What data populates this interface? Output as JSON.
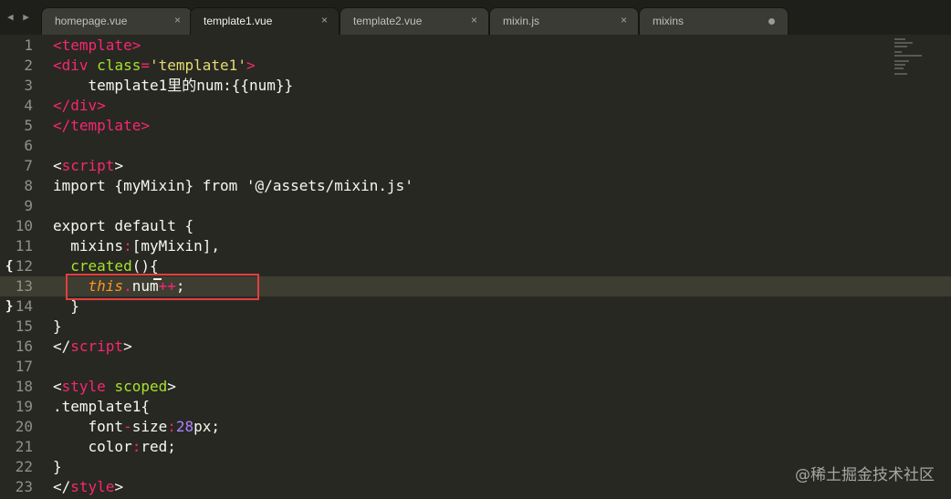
{
  "nav_arrows": "◀ ▶",
  "tabs": [
    {
      "label": "homepage.vue",
      "close": "×",
      "active": false
    },
    {
      "label": "template1.vue",
      "close": "×",
      "active": true
    },
    {
      "label": "template2.vue",
      "close": "×",
      "active": false
    },
    {
      "label": "mixin.js",
      "close": "×",
      "active": false
    },
    {
      "label": "mixins",
      "close": "",
      "dirty": true,
      "active": false
    }
  ],
  "lines": [
    {
      "n": "1",
      "parts": [
        [
          "t-tag",
          "<template>"
        ]
      ]
    },
    {
      "n": "2",
      "parts": [
        [
          "t-tag",
          "<div "
        ],
        [
          "t-attr",
          "class"
        ],
        [
          "t-op",
          "="
        ],
        [
          "t-str",
          "'template1'"
        ],
        [
          "t-tag",
          ">"
        ]
      ]
    },
    {
      "n": "3",
      "parts": [
        [
          "",
          "    template1里的num:{{num}}"
        ]
      ]
    },
    {
      "n": "4",
      "parts": [
        [
          "t-tag",
          "</div>"
        ]
      ]
    },
    {
      "n": "5",
      "parts": [
        [
          "t-tag",
          "</template>"
        ]
      ]
    },
    {
      "n": "6",
      "parts": []
    },
    {
      "n": "7",
      "parts": [
        [
          "",
          "<"
        ],
        [
          "t-tag",
          "script"
        ],
        [
          "",
          ">"
        ]
      ]
    },
    {
      "n": "8",
      "parts": [
        [
          "",
          "import {myMixin} from '@/assets/mixin.js'"
        ]
      ]
    },
    {
      "n": "9",
      "parts": []
    },
    {
      "n": "10",
      "parts": [
        [
          "",
          "export default {"
        ]
      ]
    },
    {
      "n": "11",
      "parts": [
        [
          "",
          "  mixins"
        ],
        [
          "t-op",
          ":"
        ],
        [
          "",
          "[myMixin],"
        ]
      ]
    },
    {
      "n": "12",
      "fold": "{",
      "parts": [
        [
          "",
          "  "
        ],
        [
          "t-fn",
          "created"
        ],
        [
          "",
          "(){"
        ]
      ]
    },
    {
      "n": "13",
      "highlight": true,
      "parts": [
        [
          "",
          "    "
        ],
        [
          "t-this",
          "this"
        ],
        [
          "t-op",
          "."
        ],
        [
          "",
          "num"
        ],
        [
          "t-op",
          "++"
        ],
        [
          "",
          ";"
        ]
      ]
    },
    {
      "n": "14",
      "fold": "}",
      "parts": [
        [
          "",
          "  }"
        ]
      ]
    },
    {
      "n": "15",
      "parts": [
        [
          "",
          "}"
        ]
      ]
    },
    {
      "n": "16",
      "parts": [
        [
          "",
          "</"
        ],
        [
          "t-tag",
          "script"
        ],
        [
          "",
          ">"
        ]
      ]
    },
    {
      "n": "17",
      "parts": []
    },
    {
      "n": "18",
      "parts": [
        [
          "",
          "<"
        ],
        [
          "t-tag",
          "style "
        ],
        [
          "t-attr",
          "scoped"
        ],
        [
          "",
          ">"
        ]
      ]
    },
    {
      "n": "19",
      "parts": [
        [
          "",
          ".template1{"
        ]
      ]
    },
    {
      "n": "20",
      "parts": [
        [
          "",
          "    font"
        ],
        [
          "t-op",
          "-"
        ],
        [
          "",
          "size"
        ],
        [
          "t-op",
          ":"
        ],
        [
          "t-num",
          "28"
        ],
        [
          "",
          "px;"
        ]
      ]
    },
    {
      "n": "21",
      "parts": [
        [
          "",
          "    color"
        ],
        [
          "t-op",
          ":"
        ],
        [
          "",
          "red;"
        ]
      ]
    },
    {
      "n": "22",
      "parts": [
        [
          "",
          "}"
        ]
      ]
    },
    {
      "n": "23",
      "parts": [
        [
          "",
          "</"
        ],
        [
          "t-tag",
          "style"
        ],
        [
          "",
          ">"
        ]
      ]
    }
  ],
  "watermark": "@稀土掘金技术社区"
}
